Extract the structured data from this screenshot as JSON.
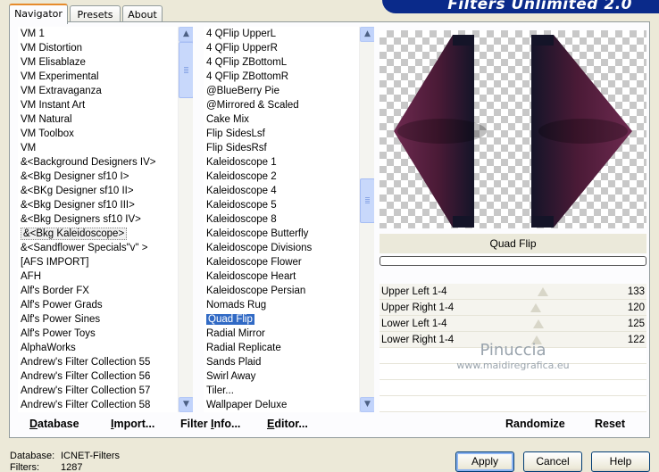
{
  "banner": {
    "title": "Filters Unlimited 2.0"
  },
  "tabs": [
    {
      "label": "Navigator",
      "active": true
    },
    {
      "label": "Presets",
      "active": false
    },
    {
      "label": "About",
      "active": false
    }
  ],
  "categories": {
    "items": [
      "VM 1",
      "VM Distortion",
      "VM Elisablaze",
      "VM Experimental",
      "VM Extravaganza",
      "VM Instant Art",
      "VM Natural",
      "VM Toolbox",
      "VM",
      "&<Background Designers IV>",
      "&<Bkg Designer sf10 I>",
      "&<BKg Designer sf10 II>",
      "&<Bkg Designer sf10 III>",
      "&<Bkg Designers sf10 IV>",
      "&<Bkg Kaleidoscope>",
      "&<Sandflower Specials\"v\" >",
      "[AFS IMPORT]",
      "AFH",
      "Alf's Border FX",
      "Alf's Power Grads",
      "Alf's Power Sines",
      "Alf's Power Toys",
      "AlphaWorks",
      "Andrew's Filter Collection 55",
      "Andrew's Filter Collection 56",
      "Andrew's Filter Collection 57",
      "Andrew's Filter Collection 58"
    ],
    "highlighted": "&<Bkg Kaleidoscope>"
  },
  "filters": {
    "items": [
      "4 QFlip UpperL",
      "4 QFlip UpperR",
      "4 QFlip ZBottomL",
      "4 QFlip ZBottomR",
      "@BlueBerry Pie",
      "@Mirrored & Scaled",
      "Cake Mix",
      "Flip SidesLsf",
      "Flip SidesRsf",
      "Kaleidoscope 1",
      "Kaleidoscope 2",
      "Kaleidoscope 4",
      "Kaleidoscope 5",
      "Kaleidoscope 8",
      "Kaleidoscope Butterfly",
      "Kaleidoscope Divisions",
      "Kaleidoscope Flower",
      "Kaleidoscope Heart",
      "Kaleidoscope Persian",
      "Nomads Rug",
      "Quad Flip",
      "Radial Mirror",
      "Radial Replicate",
      "Sands Plaid",
      "Swirl Away",
      "Tiler...",
      "Wallpaper Deluxe"
    ],
    "selected": "Quad Flip"
  },
  "preview": {
    "filter_name": "Quad Flip",
    "colors": {
      "fill": "#4a1a36",
      "dark": "#141428",
      "light": "#6e2a50"
    }
  },
  "parameters": [
    {
      "label": "Upper Left 1-4",
      "value": "133",
      "level": 133
    },
    {
      "label": "Upper Right 1-4",
      "value": "120",
      "level": 120
    },
    {
      "label": "Lower Left 1-4",
      "value": "125",
      "level": 125
    },
    {
      "label": "Lower Right 1-4",
      "value": "122",
      "level": 122
    }
  ],
  "watermark": {
    "line1": "Pinuccia",
    "line2": "www.maidiregrafica.eu"
  },
  "actions": {
    "database": {
      "label": "Database",
      "underline": "D",
      "rest": "atabase"
    },
    "import": {
      "label": "Import...",
      "underline": "I",
      "rest": "mport..."
    },
    "filter_info": {
      "label": "Filter Info...",
      "pre": "Filter ",
      "underline": "I",
      "rest": "nfo..."
    },
    "editor": {
      "label": "Editor...",
      "underline": "E",
      "rest": "ditor..."
    },
    "randomize": "Randomize",
    "reset": "Reset"
  },
  "status": {
    "database_key": "Database:",
    "database_value": "ICNET-Filters",
    "filters_key": "Filters:",
    "filters_value": "1287"
  },
  "buttons": {
    "apply": "Apply",
    "cancel": "Cancel",
    "help": "Help"
  }
}
